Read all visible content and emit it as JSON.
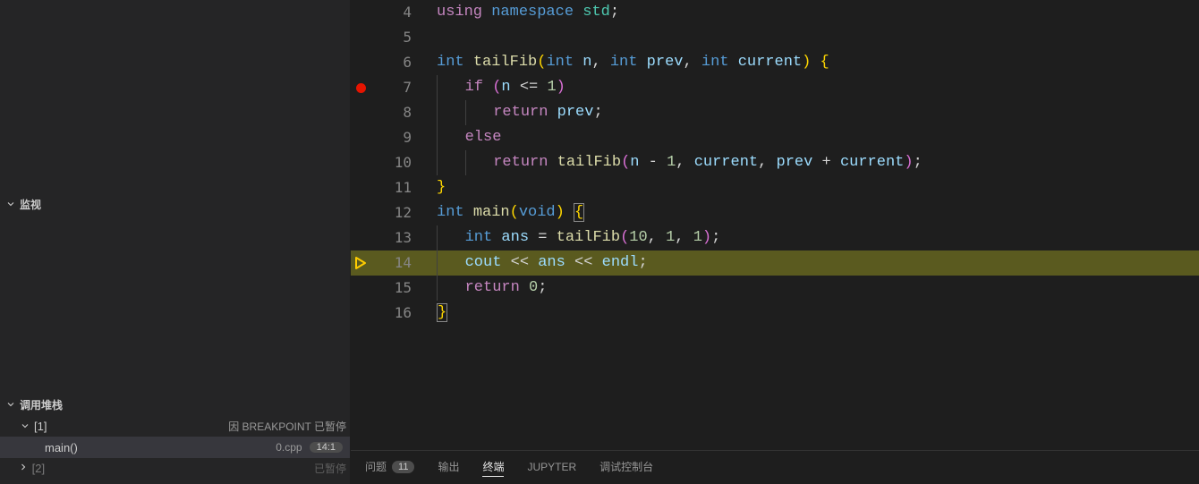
{
  "sidebar": {
    "watch_label": "监视",
    "callstack_label": "调用堆栈",
    "thread1_name": "[1]",
    "thread1_status": "因 BREAKPOINT 已暂停",
    "frame_name": "main()",
    "frame_file": "0.cpp",
    "frame_pos": "14:1",
    "thread2_name": "[2]",
    "thread2_status": "已暂停"
  },
  "code": {
    "lines": [
      {
        "n": 4
      },
      {
        "n": 5
      },
      {
        "n": 6
      },
      {
        "n": 7,
        "breakpoint": true
      },
      {
        "n": 8
      },
      {
        "n": 9
      },
      {
        "n": 10
      },
      {
        "n": 11
      },
      {
        "n": 12
      },
      {
        "n": 13
      },
      {
        "n": 14,
        "current": true
      },
      {
        "n": 15
      },
      {
        "n": 16
      }
    ],
    "tokens": {
      "using": "using",
      "namespace": "namespace",
      "std": "std",
      "int": "int",
      "tailFib": "tailFib",
      "n": "n",
      "prev": "prev",
      "current": "current",
      "if": "if",
      "return": "return",
      "else": "else",
      "main": "main",
      "void": "void",
      "ans": "ans",
      "cout": "cout",
      "endl": "endl",
      "n10": "10",
      "n1a": "1",
      "n1b": "1",
      "n1c": "1",
      "n1d": "1",
      "n0": "0"
    }
  },
  "panel": {
    "problems": "问题",
    "problems_count": "11",
    "output": "输出",
    "terminal": "终端",
    "jupyter": "JUPYTER",
    "debug_console": "调试控制台"
  }
}
